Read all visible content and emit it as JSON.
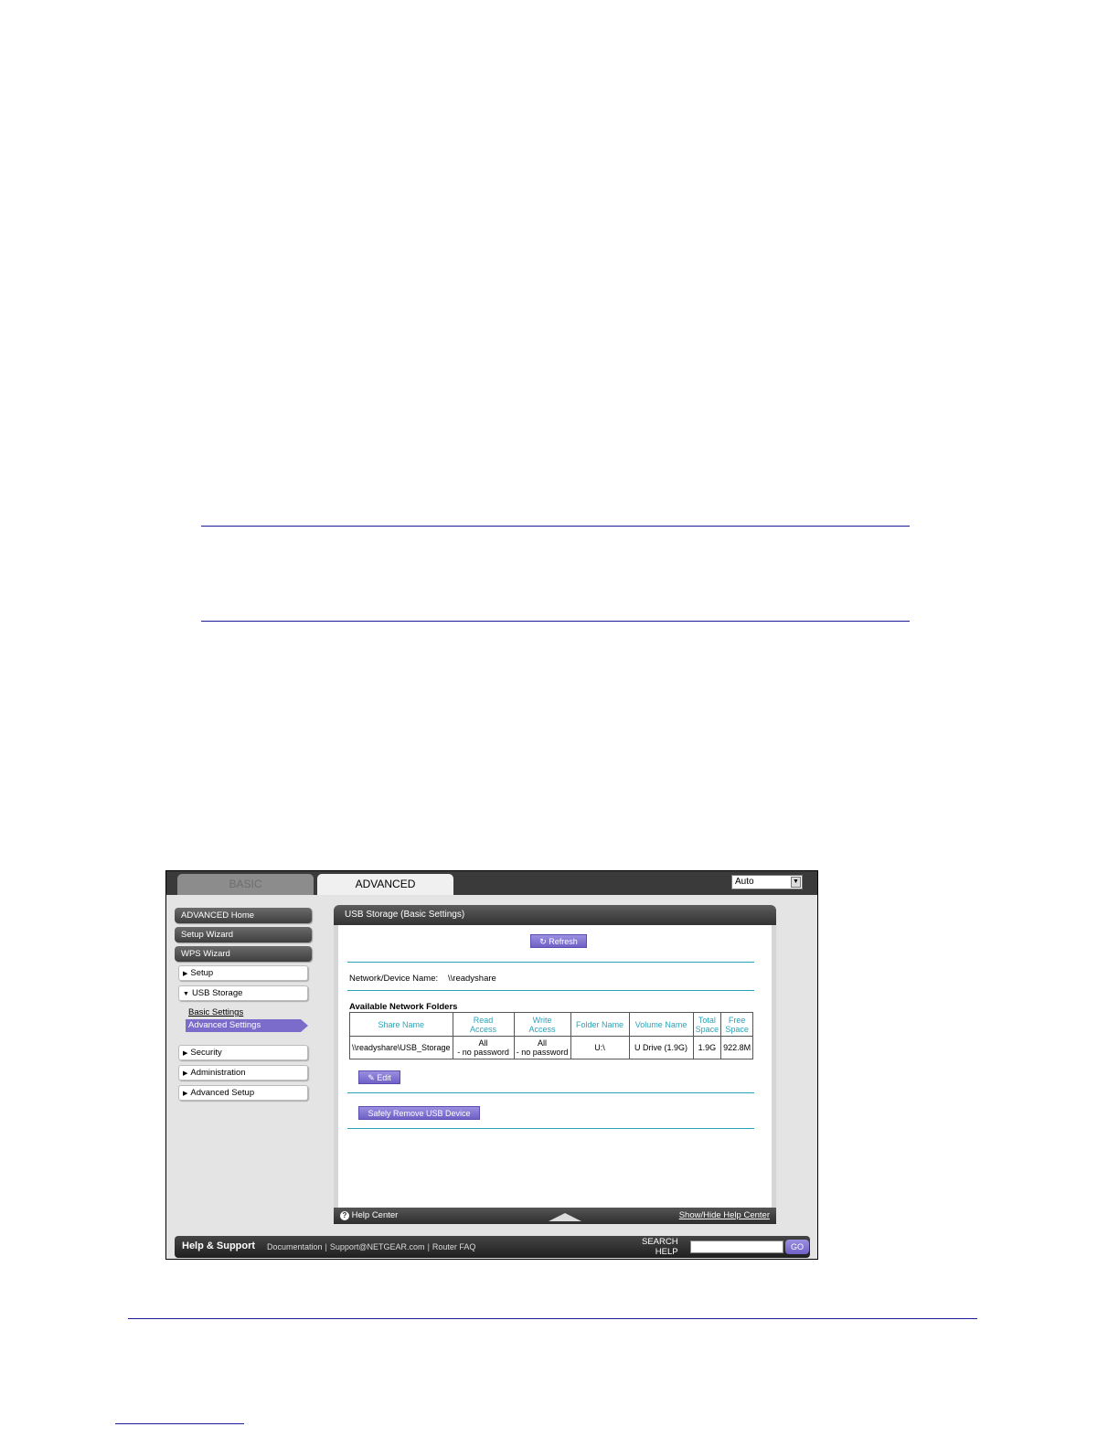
{
  "tabs": {
    "basic": "BASIC",
    "advanced": "ADVANCED"
  },
  "language_select": {
    "value": "Auto"
  },
  "sidebar": {
    "advanced_home": "ADVANCED Home",
    "setup_wizard": "Setup Wizard",
    "wps_wizard": "WPS Wizard",
    "setup": "Setup",
    "usb_storage": "USB Storage",
    "basic_settings": "Basic Settings",
    "advanced_settings": "Advanced Settings",
    "security": "Security",
    "administration": "Administration",
    "advanced_setup": "Advanced Setup"
  },
  "panel": {
    "title": "USB Storage (Basic Settings)",
    "refresh_label": "Refresh",
    "device_name_label": "Network/Device Name:",
    "device_name_value": "\\\\readyshare",
    "folders_heading": "Available Network Folders",
    "table": {
      "headers": {
        "share": "Share Name",
        "read1": "Read",
        "read2": "Access",
        "write1": "Write",
        "write2": "Access",
        "folder": "Folder Name",
        "volume": "Volume Name",
        "total1": "Total",
        "total2": "Space",
        "free1": "Free",
        "free2": "Space"
      },
      "row": {
        "share": "\\\\readyshare\\USB_Storage",
        "read1": "All",
        "read2": "- no password",
        "write1": "All",
        "write2": "- no password",
        "folder": "U:\\",
        "volume": "U Drive (1.9G)",
        "total": "1.9G",
        "free": "922.8M"
      }
    },
    "edit_label": "Edit",
    "remove_label": "Safely Remove USB Device",
    "help_center": "Help Center",
    "show_hide": "Show/Hide Help Center"
  },
  "help_support": {
    "title": "Help & Support",
    "documentation": "Documentation",
    "support_email": "Support@NETGEAR.com",
    "faq": "Router FAQ",
    "search_label_1": "SEARCH",
    "search_label_2": "HELP",
    "go": "GO"
  },
  "colors": {
    "accent": "#2aa3b8",
    "purple": "#7b6ccc",
    "rule": "#1a1a9a"
  }
}
